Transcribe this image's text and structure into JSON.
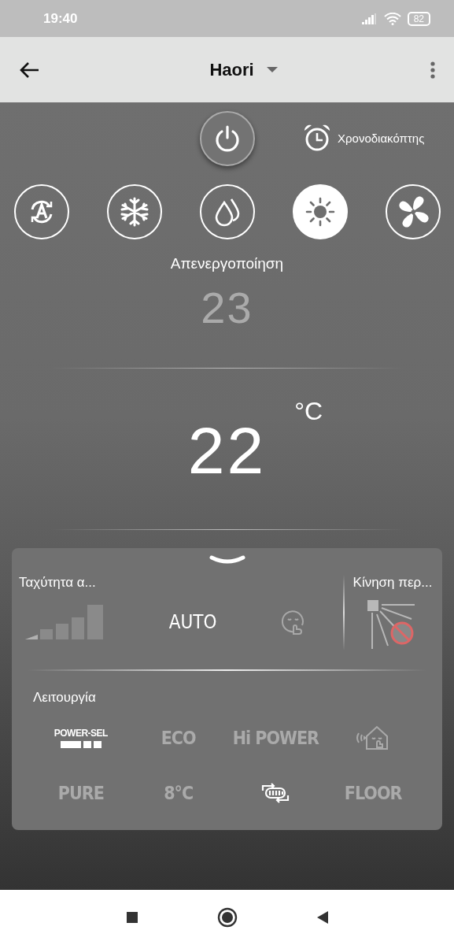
{
  "status_bar": {
    "time": "19:40",
    "battery": "82"
  },
  "app_bar": {
    "title": "Haori"
  },
  "power": {
    "on": false
  },
  "timer": {
    "label": "Χρονοδιακόπτης"
  },
  "modes": [
    {
      "kind": "auto",
      "selected": false
    },
    {
      "kind": "cool",
      "selected": false
    },
    {
      "kind": "dry",
      "selected": false
    },
    {
      "kind": "heat",
      "selected": true
    },
    {
      "kind": "fan",
      "selected": false
    }
  ],
  "status_text": "Απενεργοποίηση",
  "set_temperature": "23",
  "room_temperature": {
    "value": "22",
    "unit": "°C"
  },
  "fan_speed": {
    "label": "Ταχύτητα α...",
    "options": [
      {
        "kind": "bars",
        "selected": false
      },
      {
        "kind": "text",
        "label": "AUTO",
        "selected": true
      },
      {
        "kind": "quiet",
        "selected": false
      }
    ]
  },
  "swing": {
    "label": "Κίνηση περ..."
  },
  "functions": {
    "label": "Λειτουργία",
    "items": [
      {
        "kind": "powersel",
        "label": "POWER-SEL",
        "active": true
      },
      {
        "kind": "text",
        "label": "ECO",
        "active": false
      },
      {
        "kind": "text",
        "label": "Hi POWER",
        "active": false
      },
      {
        "kind": "silent",
        "active": false
      },
      {
        "kind": "text",
        "label": "PURE",
        "active": false
      },
      {
        "kind": "text",
        "label": "8°C",
        "active": false
      },
      {
        "kind": "clean",
        "active": true
      },
      {
        "kind": "text",
        "label": "FLOOR",
        "active": false
      }
    ]
  }
}
